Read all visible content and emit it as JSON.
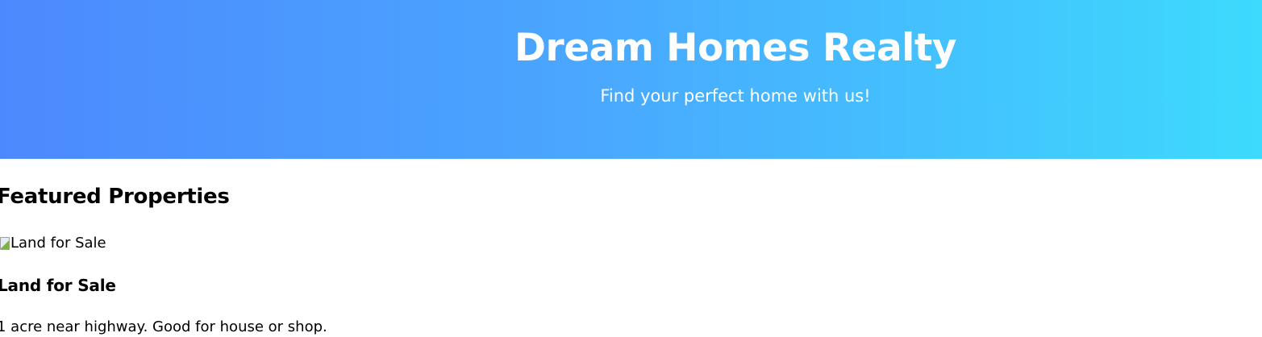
{
  "header": {
    "title": "Dream Homes Realty",
    "subtitle": "Find your perfect home with us!",
    "gradient_colors": [
      "#4c89fe",
      "#3ddafd"
    ]
  },
  "featured": {
    "heading": "Featured Properties",
    "properties": [
      {
        "image_alt": "Land for Sale",
        "image_icon": "broken-image-icon",
        "title": "Land for Sale",
        "description": "1 acre near highway. Good for house or shop."
      }
    ]
  }
}
